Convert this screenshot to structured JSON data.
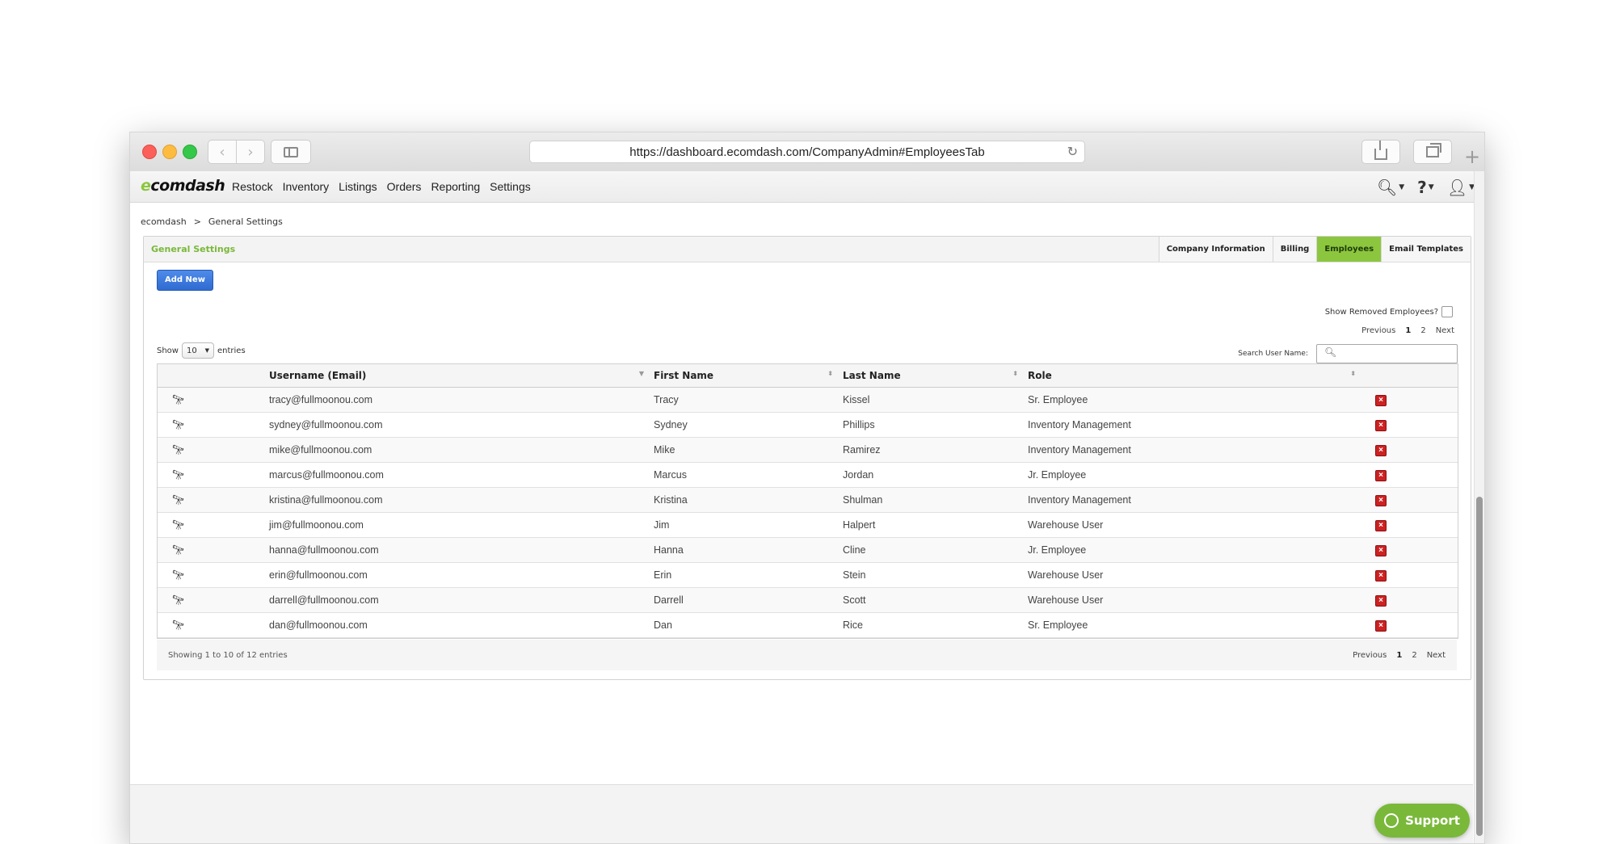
{
  "browser": {
    "url": "https://dashboard.ecomdash.com/CompanyAdmin#EmployeesTab"
  },
  "app": {
    "logo_prefix": "e",
    "logo_rest": "comdash",
    "menu": [
      "Restock",
      "Inventory",
      "Listings",
      "Orders",
      "Reporting",
      "Settings"
    ]
  },
  "breadcrumb": {
    "home": "ecomdash",
    "sep": ">",
    "current": "General Settings"
  },
  "panel": {
    "title": "General Settings",
    "tabs": [
      "Company Information",
      "Billing",
      "Employees",
      "Email Templates"
    ],
    "active_tab": "Employees"
  },
  "toolbar": {
    "add_new": "Add New",
    "show_removed": "Show Removed Employees?",
    "show_label": "Show",
    "entries_label": "entries",
    "page_length": "10",
    "search_label": "Search User Name:",
    "search_value": ""
  },
  "pager": {
    "previous": "Previous",
    "pages": [
      "1",
      "2"
    ],
    "current": "1",
    "next": "Next"
  },
  "table": {
    "headers": [
      "Username (Email)",
      "First Name",
      "Last Name",
      "Role"
    ],
    "rows": [
      {
        "email": "tracy@fullmoonou.com",
        "first": "Tracy",
        "last": "Kissel",
        "role": "Sr. Employee"
      },
      {
        "email": "sydney@fullmoonou.com",
        "first": "Sydney",
        "last": "Phillips",
        "role": "Inventory Management"
      },
      {
        "email": "mike@fullmoonou.com",
        "first": "Mike",
        "last": "Ramirez",
        "role": "Inventory Management"
      },
      {
        "email": "marcus@fullmoonou.com",
        "first": "Marcus",
        "last": "Jordan",
        "role": "Jr. Employee"
      },
      {
        "email": "kristina@fullmoonou.com",
        "first": "Kristina",
        "last": "Shulman",
        "role": "Inventory Management"
      },
      {
        "email": "jim@fullmoonou.com",
        "first": "Jim",
        "last": "Halpert",
        "role": "Warehouse User"
      },
      {
        "email": "hanna@fullmoonou.com",
        "first": "Hanna",
        "last": "Cline",
        "role": "Jr. Employee"
      },
      {
        "email": "erin@fullmoonou.com",
        "first": "Erin",
        "last": "Stein",
        "role": "Warehouse User"
      },
      {
        "email": "darrell@fullmoonou.com",
        "first": "Darrell",
        "last": "Scott",
        "role": "Warehouse User"
      },
      {
        "email": "dan@fullmoonou.com",
        "first": "Dan",
        "last": "Rice",
        "role": "Sr. Employee"
      }
    ],
    "info": "Showing 1 to 10 of 12 entries"
  },
  "support": {
    "label": "Support"
  },
  "colors": {
    "accent": "#8cc63f",
    "button_blue": "#2f6bd0",
    "delete_red": "#cc2222"
  }
}
